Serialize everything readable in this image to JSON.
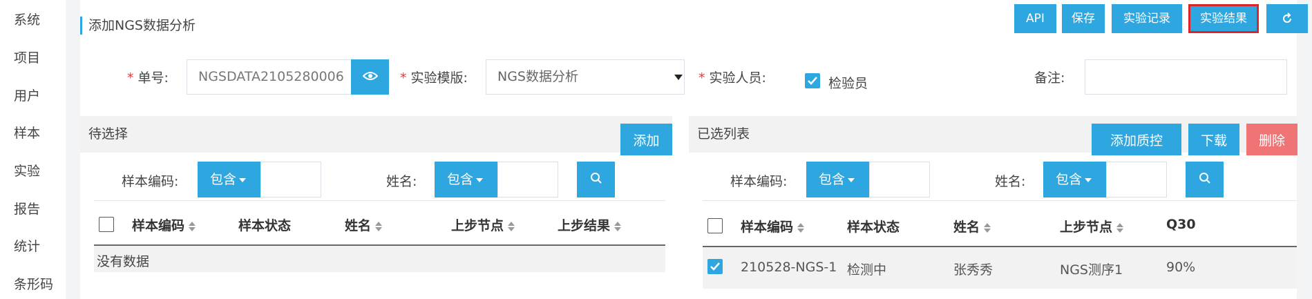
{
  "nav": [
    "系统",
    "项目",
    "用户",
    "样本",
    "实验",
    "报告",
    "统计",
    "条形码"
  ],
  "page": {
    "title": "添加NGS数据分析"
  },
  "toolbar": {
    "api": "API",
    "save": "保存",
    "record": "实验记录",
    "result": "实验结果",
    "refresh_icon": "refresh-icon"
  },
  "form": {
    "order_label": "单号:",
    "order_value": "NGSDATA2105280006",
    "template_label": "实验模版:",
    "template_value": "NGS数据分析",
    "person_label": "实验人员:",
    "person_value": "检验员",
    "person_checked": true,
    "note_label": "备注:",
    "note_value": "",
    "required_mark": "*"
  },
  "pending": {
    "title": "待选择",
    "add_button": "添加",
    "filter_code_label": "样本编码:",
    "filter_code_mode": "包含",
    "filter_name_label": "姓名:",
    "filter_name_mode": "包含",
    "columns": [
      "样本编码",
      "样本状态",
      "姓名",
      "上步节点",
      "上步结果"
    ],
    "empty_text": "没有数据"
  },
  "selected": {
    "title": "已选列表",
    "add_qc_button": "添加质控",
    "download_button": "下载",
    "delete_button": "删除",
    "filter_code_label": "样本编码:",
    "filter_code_mode": "包含",
    "filter_name_label": "姓名:",
    "filter_name_mode": "包含",
    "columns": [
      "样本编码",
      "样本状态",
      "姓名",
      "上步节点",
      "Q30"
    ],
    "rows": [
      {
        "code": "210528-NGS-1",
        "status": "检测中",
        "name": "张秀秀",
        "prev_node": "NGS测序1",
        "q30": "90%",
        "checked": true
      }
    ]
  },
  "colors": {
    "primary": "#2ea7e0",
    "danger": "#f07475",
    "highlight": "#d9262b"
  }
}
